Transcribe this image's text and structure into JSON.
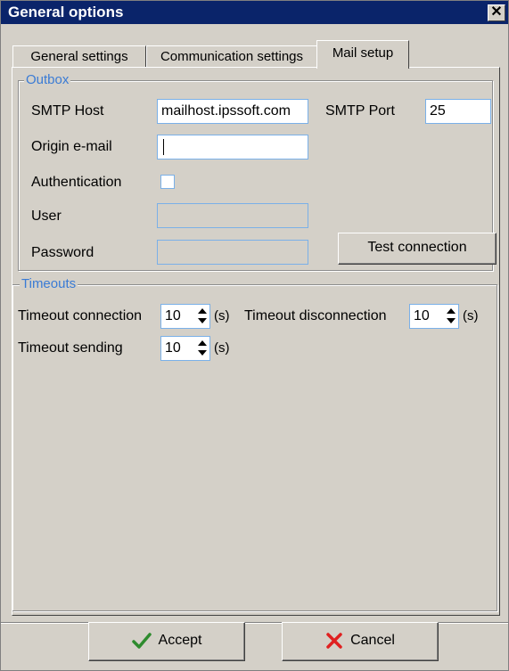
{
  "window": {
    "title": "General options",
    "close_glyph": "✕"
  },
  "tabs": [
    {
      "label": "General settings"
    },
    {
      "label": "Communication settings"
    },
    {
      "label": "Mail setup",
      "active": true
    }
  ],
  "outbox": {
    "legend": "Outbox",
    "smtp_host_label": "SMTP Host",
    "smtp_host_value": "mailhost.ipssoft.com",
    "smtp_port_label": "SMTP Port",
    "smtp_port_value": "25",
    "origin_email_label": "Origin e-mail",
    "origin_email_value": "",
    "authentication_label": "Authentication",
    "authentication_checked": false,
    "user_label": "User",
    "user_value": "",
    "password_label": "Password",
    "password_value": "",
    "test_connection_label": "Test connection"
  },
  "timeouts": {
    "legend": "Timeouts",
    "connection_label": "Timeout connection",
    "connection_value": "10",
    "disconnection_label": "Timeout disconnection",
    "disconnection_value": "10",
    "sending_label": "Timeout sending",
    "sending_value": "10",
    "unit": "(s)"
  },
  "buttons": {
    "accept_label": "Accept",
    "accept_icon": "checkmark-icon",
    "cancel_label": "Cancel",
    "cancel_icon": "x-icon"
  },
  "colors": {
    "titlebar": "#0a246a",
    "dialog_face": "#d4d0c8",
    "legend_text": "#3a7bd5",
    "accept_check": "#2e8b2e",
    "cancel_x": "#e02020"
  }
}
